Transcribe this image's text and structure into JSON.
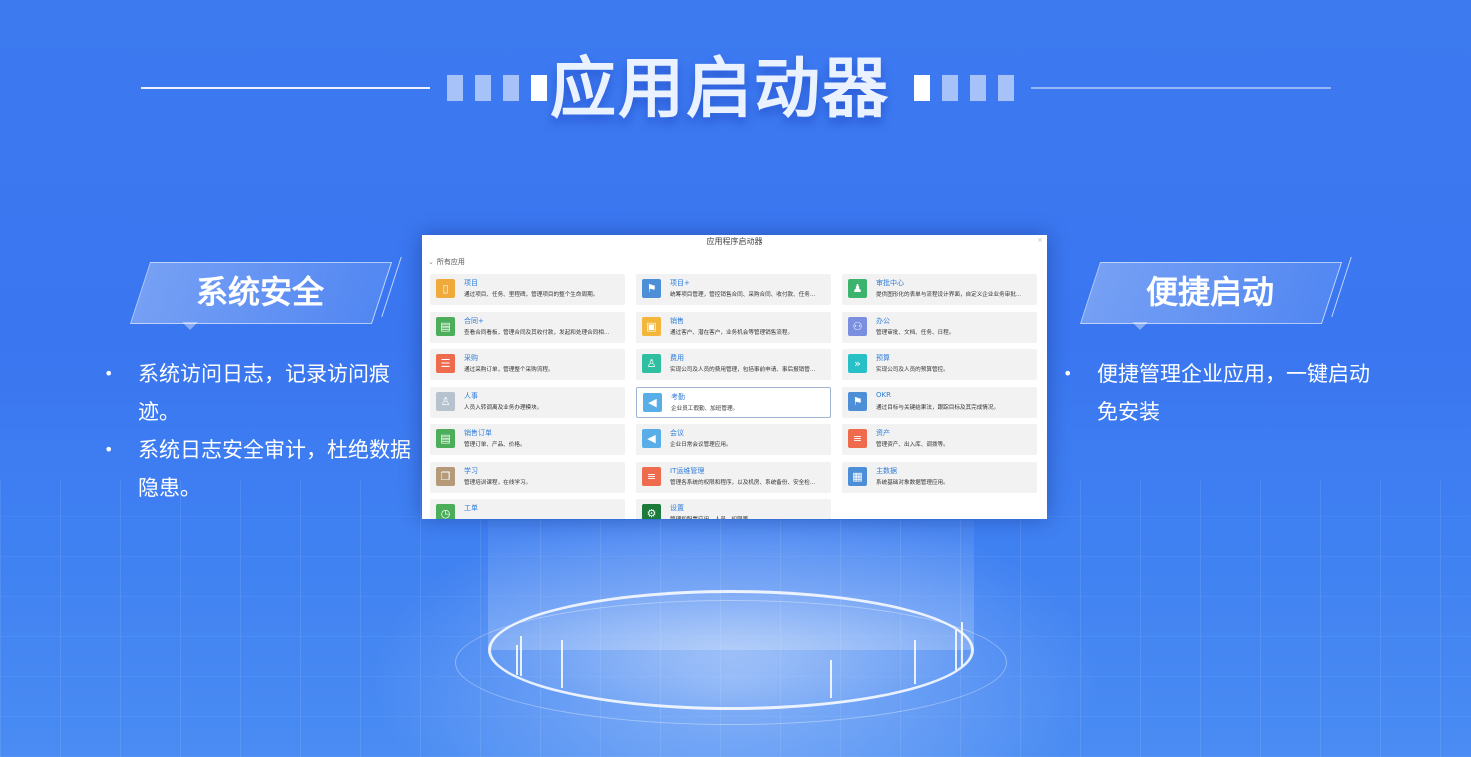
{
  "header": {
    "title": "应用启动器"
  },
  "left_feature": {
    "title": "系统安全",
    "bullets": [
      "系统访问日志，记录访问痕迹。",
      "系统日志安全审计，杜绝数据隐患。"
    ]
  },
  "right_feature": {
    "title": "便捷启动",
    "bullets": [
      "便捷管理企业应用，一键启动免安装"
    ]
  },
  "window": {
    "title": "应用程序启动器",
    "section_label": "所有应用",
    "apps": [
      {
        "name": "项目",
        "desc": "通过项目、任务、里程碑，管理项目的整个生命周期。",
        "color": "#f0a93b",
        "icon": "▯"
      },
      {
        "name": "项目+",
        "desc": "统筹项目管理，管控销售合同、采购合同、收付款、任务…",
        "color": "#4c8fd6",
        "icon": "⚑"
      },
      {
        "name": "审批中心",
        "desc": "提供图形化的表单与流程设计界面，自定义企业业务审批…",
        "color": "#3db46d",
        "icon": "♟"
      },
      {
        "name": "合同+",
        "desc": "查看合同看板，管理合同及其收付款，发起和处理合同相…",
        "color": "#4cae5a",
        "icon": "▤"
      },
      {
        "name": "销售",
        "desc": "通过客户、潜在客户，业务机会等管理销售流程。",
        "color": "#f2b63a",
        "icon": "▣"
      },
      {
        "name": "办公",
        "desc": "管理审批、文档、任务、日程。",
        "color": "#7b8fe0",
        "icon": "⚇"
      },
      {
        "name": "采购",
        "desc": "通过采购订单，管理整个采购流程。",
        "color": "#ee6b4d",
        "icon": "☰"
      },
      {
        "name": "费用",
        "desc": "实现公司及人员的费用管理，包括事前申请、事后报销管…",
        "color": "#2fbfa0",
        "icon": "♙"
      },
      {
        "name": "预算",
        "desc": "实现公司及人员的预算管控。",
        "color": "#27c0c6",
        "icon": "»"
      },
      {
        "name": "人事",
        "desc": "人员入转调离及业务办理模块。",
        "color": "#b7c2cf",
        "icon": "♙"
      },
      {
        "name": "考勤",
        "desc": "企业员工假勤、加班管理。",
        "color": "#5aaee8",
        "icon": "◀"
      },
      {
        "name": "OKR",
        "desc": "通过目标与关键结果法，跟踪目标及其完成情况。",
        "color": "#4c8fd6",
        "icon": "⚑"
      },
      {
        "name": "销售订单",
        "desc": "管理订单、产品、价格。",
        "color": "#4cae5a",
        "icon": "▤"
      },
      {
        "name": "会议",
        "desc": "企业日常会议管理应用。",
        "color": "#5aaee8",
        "icon": "◀"
      },
      {
        "name": "资产",
        "desc": "管理资产、出入库、调拨等。",
        "color": "#ee6b4d",
        "icon": "≡"
      },
      {
        "name": "学习",
        "desc": "管理培训课程，在线学习。",
        "color": "#b59a7a",
        "icon": "❐"
      },
      {
        "name": "IT运维管理",
        "desc": "管理各系统的权限和程序，以及机房、系统备份、安全检…",
        "color": "#ee6b4d",
        "icon": "≡"
      },
      {
        "name": "主数据",
        "desc": "系统基础对象数据管理应用。",
        "color": "#4c8fd6",
        "icon": "▦"
      },
      {
        "name": "工单",
        "desc": "",
        "color": "#4cae5a",
        "icon": "◷"
      },
      {
        "name": "设置",
        "desc": "管理和配置应用、人员、权限等",
        "color": "#1c7a3a",
        "icon": "⚙"
      }
    ]
  }
}
